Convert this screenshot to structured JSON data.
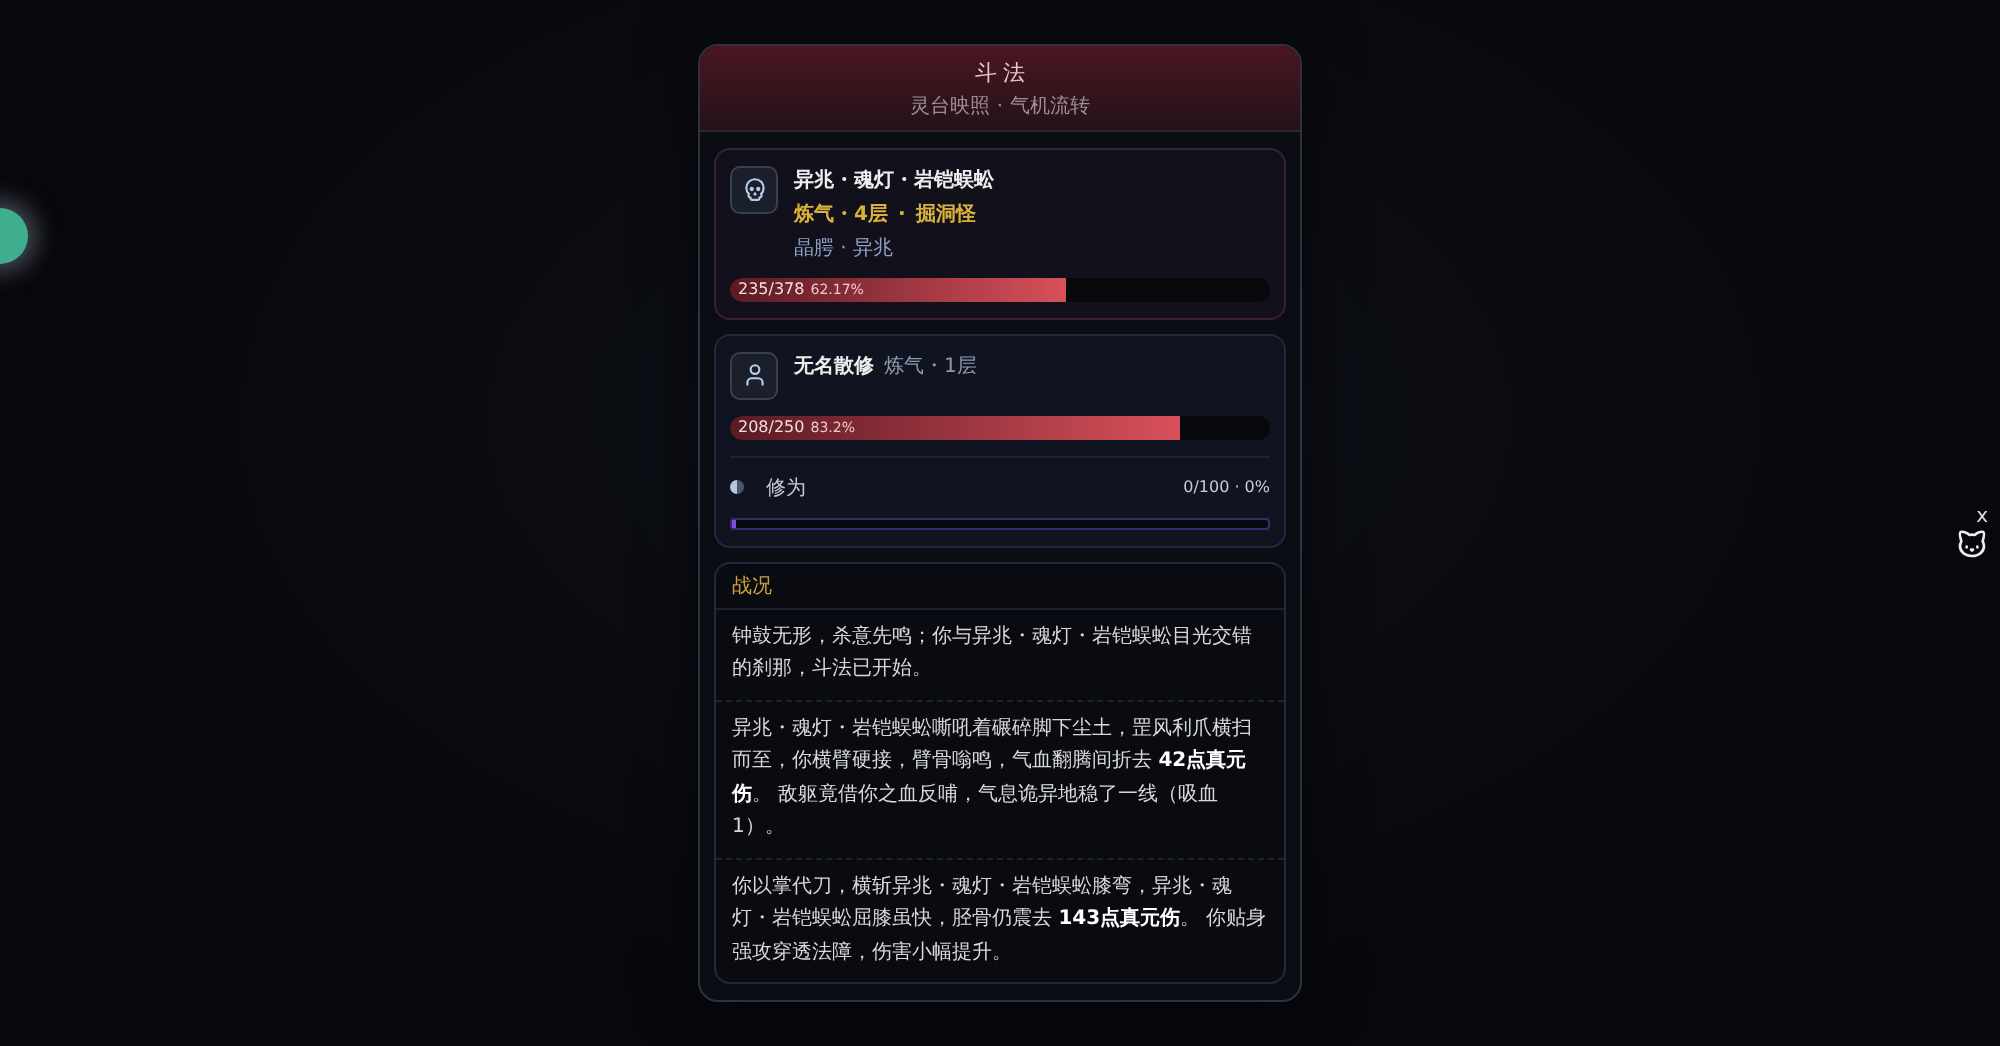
{
  "dialog": {
    "title": "斗 法",
    "subtitle": "灵台映照 · 气机流转"
  },
  "enemy": {
    "name": "异兆・魂灯・岩铠蜈蚣",
    "rank": "炼气・4层",
    "rank_sep": "·",
    "type": "掘洞怪",
    "traits": "晶腭 · 异兆",
    "hp": {
      "reading": "235/378",
      "percent": "62.17%",
      "level": 0.6217
    }
  },
  "player": {
    "name": "无名散修",
    "rank": "炼气・1层",
    "hp": {
      "reading": "208/250",
      "percent": "83.2%",
      "level": 0.832
    },
    "cultivation": {
      "label": "修为",
      "reading": "0/100 · 0%",
      "level": 0
    }
  },
  "log": {
    "title": "战况",
    "entries": [
      "钟鼓无形，杀意先鸣；你与异兆・魂灯・岩铠蜈蚣目光交错的刹那，斗法已开始。",
      "异兆・魂灯・岩铠蜈蚣嘶吼着碾碎脚下尘土，罡风利爪横扫而至，你横臂硬接，臂骨嗡鸣，气血翻腾间折去 **42点真元伤**。 敌躯竟借你之血反哺，气息诡异地稳了一线（吸血 1）。",
      "你以掌代刀，横斩异兆・魂灯・岩铠蜈蚣膝弯，异兆・魂灯・岩铠蜈蚣屈膝虽快，胫骨仍震去 **143点真元伤**。 你贴身强攻穿透法障，伤害小幅提升。"
    ]
  },
  "floating_pet": {
    "close": "x"
  }
}
